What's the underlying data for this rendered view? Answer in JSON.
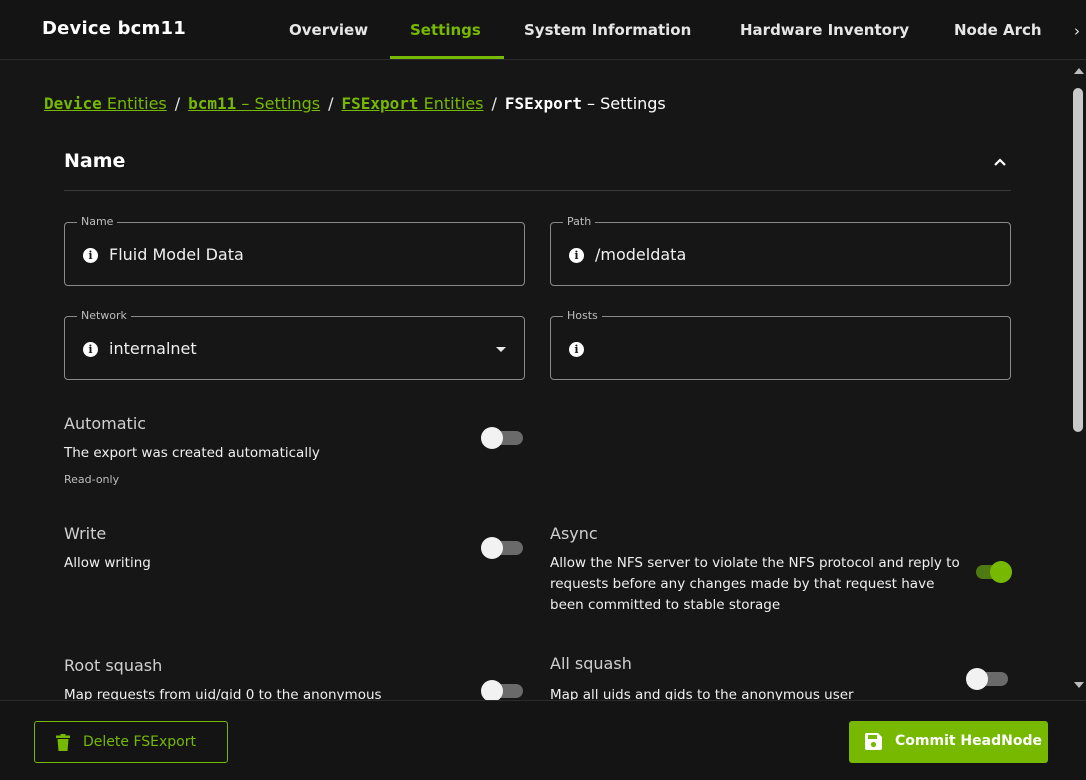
{
  "header": {
    "device_title": "Device bcm11",
    "tabs": [
      {
        "label": "Overview"
      },
      {
        "label": "Settings"
      },
      {
        "label": "System Information"
      },
      {
        "label": "Hardware Inventory"
      },
      {
        "label": "Node Arch"
      }
    ],
    "active_tab": "Settings",
    "next_icon": "chevron-right-icon"
  },
  "breadcrumb": {
    "items": [
      {
        "bold": "Device",
        "rest": " Entities"
      },
      {
        "bold": "bcm11",
        "rest": " – Settings"
      },
      {
        "bold": "FSExport",
        "rest": " Entities"
      }
    ],
    "current_bold": "FSExport",
    "current_rest": " – Settings",
    "separator": "/"
  },
  "section": {
    "title": "Name",
    "collapse_icon": "chevron-up-icon"
  },
  "fields": {
    "name": {
      "label": "Name",
      "value": "Fluid Model Data"
    },
    "path": {
      "label": "Path",
      "value": "/modeldata"
    },
    "network": {
      "label": "Network",
      "value": "internalnet"
    },
    "hosts": {
      "label": "Hosts",
      "value": ""
    }
  },
  "options": {
    "automatic": {
      "title": "Automatic",
      "description": "The export was created automatically",
      "note": "Read-only",
      "enabled": false
    },
    "write": {
      "title": "Write",
      "description": "Allow writing",
      "enabled": false
    },
    "async": {
      "title": "Async",
      "description": "Allow the NFS server to violate the NFS protocol and reply to requests before any changes made by that request have been committed to stable storage",
      "enabled": true
    },
    "root_squash": {
      "title": "Root squash",
      "description": "Map requests from uid/gid 0 to the anonymous",
      "enabled": false
    },
    "all_squash": {
      "title": "All squash",
      "description": "Map all uids and gids to the anonymous user",
      "enabled": false
    }
  },
  "footer": {
    "delete_label": "Delete FSExport",
    "commit_label": "Commit HeadNode"
  },
  "colors": {
    "accent": "#76b900",
    "background": "#161616"
  }
}
